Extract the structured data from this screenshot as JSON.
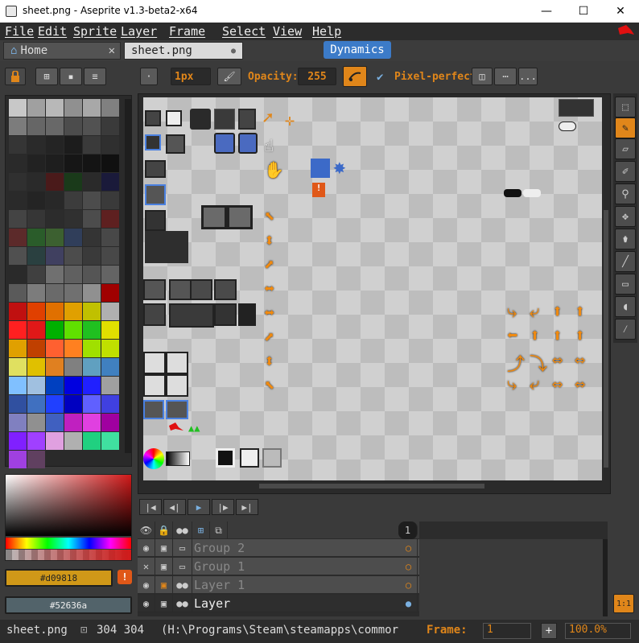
{
  "window": {
    "title": "sheet.png - Aseprite v1.3-beta2-x64",
    "minimize": "—",
    "maximize": "☐",
    "close": "✕"
  },
  "menu": [
    "File",
    "Edit",
    "Sprite",
    "Layer",
    "Frame",
    "Select",
    "View",
    "Help"
  ],
  "tabs": {
    "home": "Home",
    "home_close": "✕",
    "sheet": "sheet.png",
    "sheet_dot": "●"
  },
  "tooltip": "Dynamics",
  "toolbar": {
    "brush_size": "1px",
    "opacity_label": "Opacity:",
    "opacity_value": "255",
    "pixel_perfect_label": "Pixel-perfect",
    "more": "..."
  },
  "colors": {
    "fg_hex": "#d09818",
    "bg_hex": "#52636a",
    "fg": "#d09818",
    "bg": "#52636a",
    "accent": "#e0861a"
  },
  "palette": [
    "#c8c8c8",
    "#a0a0a0",
    "#b8b8b8",
    "#909090",
    "#a8a8a8",
    "#808080",
    "#7c7c7c",
    "#666666",
    "#686868",
    "#4c4c4c",
    "#525252",
    "#3a3a3a",
    "#353535",
    "#2a2a2a",
    "#242424",
    "#1c1c1c",
    "#3a3a3a",
    "#2f2f2f",
    "#2a2a2a",
    "#222222",
    "#1e1e1e",
    "#161616",
    "#141414",
    "#101010",
    "#303030",
    "#2a2a2a",
    "#4a1a1a",
    "#1a3a1a",
    "#2a2a2a",
    "#1a1a3a",
    "#2a2a2a",
    "#242424",
    "#282828",
    "#3c3c3c",
    "#4c4c4c",
    "#3a3a3a",
    "#444444",
    "#363636",
    "#2c2c2c",
    "#303030",
    "#4c4c4c",
    "#5e2020",
    "#5c2a2a",
    "#2a5c2a",
    "#3c6030",
    "#303e5a",
    "#343434",
    "#484848",
    "#505050",
    "#2a4040",
    "#404060",
    "#4c4c4c",
    "#3a3a3a",
    "#484848",
    "#2a2a2a",
    "#404040",
    "#707070",
    "#606060",
    "#555555",
    "#646464",
    "#5a5a5a",
    "#7c7c7c",
    "#6a6a6a",
    "#707070",
    "#909090",
    "#a00000",
    "#c01010",
    "#e04000",
    "#e07000",
    "#e0a000",
    "#c0c000",
    "#b0b0b0",
    "#ff2020",
    "#e01818",
    "#00b000",
    "#60e000",
    "#20c020",
    "#e0e000",
    "#e0a000",
    "#c04000",
    "#ff6030",
    "#ff8020",
    "#a0e000",
    "#c0e000",
    "#e0e060",
    "#e0c000",
    "#e08020",
    "#808080",
    "#60a0c0",
    "#4080c0",
    "#80c0ff",
    "#a0c0e0",
    "#0040c0",
    "#0000e0",
    "#2020ff",
    "#a0a0a0",
    "#3050a0",
    "#4070c0",
    "#2040ff",
    "#0000c0",
    "#6060ff",
    "#4040e0",
    "#8080c0",
    "#909090",
    "#4060c0",
    "#c020c0",
    "#e040e0",
    "#a000a0",
    "#8020ff",
    "#a040ff",
    "#e0a0e0",
    "#b0b0b0",
    "#20d080",
    "#40e0a0",
    "#a040e0",
    "#604060"
  ],
  "timeline": {
    "play_first": "|◀",
    "play_prev": "◀|",
    "play": "▶",
    "play_next": "|▶",
    "play_last": "▶|",
    "frame_number": "1",
    "layers": [
      {
        "name": "Group 2"
      },
      {
        "name": "Group 1"
      },
      {
        "name": "Layer 1"
      },
      {
        "name": "Layer"
      }
    ]
  },
  "status": {
    "file": "sheet.png",
    "size": "304 304",
    "path": "(H:\\Programs\\Steam\\steamapps\\commor",
    "frame_label": "Frame:",
    "frame_value": "1",
    "plus": "+",
    "zoom": "100.0%",
    "zoom_reset": "1:1"
  }
}
